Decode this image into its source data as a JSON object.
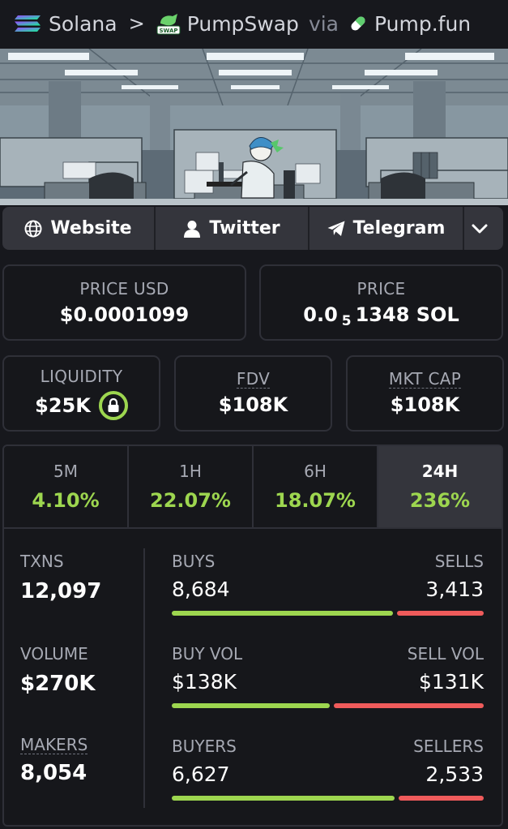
{
  "header": {
    "chain": "Solana",
    "separator": ">",
    "dex": "PumpSwap",
    "dex_badge": "SWAP",
    "via": "via",
    "platform": "Pump.fun"
  },
  "links": {
    "website": "Website",
    "twitter": "Twitter",
    "telegram": "Telegram"
  },
  "price_usd": {
    "label": "PRICE USD",
    "value": "$0.0001099"
  },
  "price_native": {
    "label": "PRICE",
    "prefix": "0.0",
    "zeros": "5",
    "digits": "1348",
    "unit": "SOL"
  },
  "liquidity": {
    "label": "LIQUIDITY",
    "value": "$25K"
  },
  "fdv": {
    "label": "FDV",
    "value": "$108K"
  },
  "mkt_cap": {
    "label": "MKT CAP",
    "value": "$108K"
  },
  "timeframes": [
    {
      "label": "5M",
      "change": "4.10%"
    },
    {
      "label": "1H",
      "change": "22.07%"
    },
    {
      "label": "6H",
      "change": "18.07%"
    },
    {
      "label": "24H",
      "change": "236%",
      "active": true
    }
  ],
  "stats": {
    "txns": {
      "label": "TXNS",
      "value": "12,097"
    },
    "volume": {
      "label": "VOLUME",
      "value": "$270K"
    },
    "makers": {
      "label": "MAKERS",
      "value": "8,054"
    },
    "buys": {
      "label": "BUYS",
      "value": "8,684",
      "share": 0.718
    },
    "sells": {
      "label": "SELLS",
      "value": "3,413"
    },
    "buy_vol": {
      "label": "BUY VOL",
      "value": "$138K",
      "share": 0.513
    },
    "sell_vol": {
      "label": "SELL VOL",
      "value": "$131K"
    },
    "buyers": {
      "label": "BUYERS",
      "value": "6,627",
      "share": 0.724
    },
    "sellers": {
      "label": "SELLERS",
      "value": "2,533"
    }
  },
  "colors": {
    "positive": "#9dd64f",
    "negative": "#ef5b5b",
    "panel": "#16171b",
    "active_tab": "#34353c"
  }
}
